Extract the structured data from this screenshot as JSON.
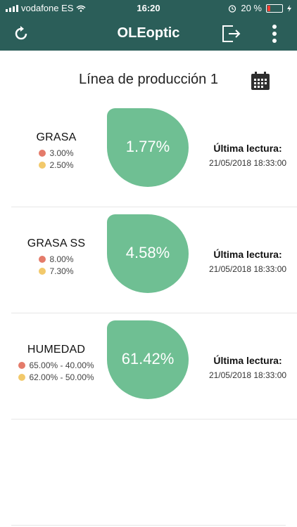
{
  "status": {
    "carrier": "vodafone ES",
    "time": "16:20",
    "battery_percent": "20 %",
    "battery_level": 0.2,
    "battery_color": "#ff3b30"
  },
  "header": {
    "title": "OLEoptic",
    "bg_color": "#2b5e59",
    "icons": [
      "refresh-icon",
      "logout-icon",
      "more-vert-icon"
    ]
  },
  "page": {
    "line_title": "Línea de producción 1",
    "calendar_icon": "calendar-icon"
  },
  "colors": {
    "accent_green": "#6fbf93",
    "legend_red": "#e47b6a",
    "legend_yellow": "#f2c96b"
  },
  "cards": [
    {
      "name": "GRASA",
      "legend_red": "3.00%",
      "legend_yellow": "2.50%",
      "value": "1.77%",
      "last_label": "Última lectura:",
      "last_time": "21/05/2018 18:33:00"
    },
    {
      "name": "GRASA SS",
      "legend_red": "8.00%",
      "legend_yellow": "7.30%",
      "value": "4.58%",
      "last_label": "Última lectura:",
      "last_time": "21/05/2018 18:33:00"
    },
    {
      "name": "HUMEDAD",
      "legend_red": "65.00% - 40.00%",
      "legend_yellow": "62.00% - 50.00%",
      "value": "61.42%",
      "last_label": "Última lectura:",
      "last_time": "21/05/2018 18:33:00"
    }
  ]
}
